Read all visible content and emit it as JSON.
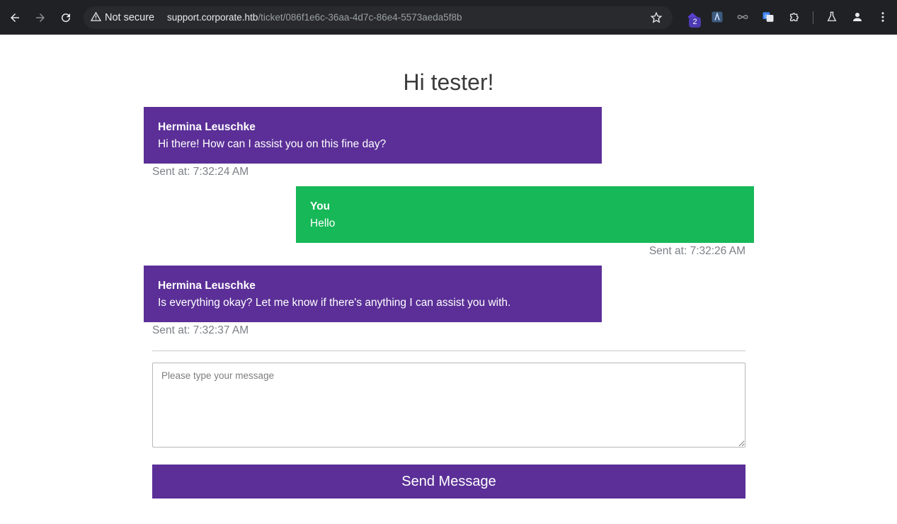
{
  "browser": {
    "security_label": "Not secure",
    "url_host": "support.corporate.htb",
    "url_path": "/ticket/086f1e6c-36aa-4d7c-86e4-5573aeda5f8b",
    "extension_badge": "2",
    "icons": [
      "back-icon",
      "forward-icon",
      "reload-icon",
      "warning-icon",
      "star-icon",
      "extension-icon",
      "puzzle-icon",
      "labs-icon",
      "profile-icon",
      "menu-icon"
    ]
  },
  "page": {
    "greeting": "Hi tester!",
    "messages": [
      {
        "sender": "Hermina Leuschke",
        "text": "Hi there! How can I assist you on this fine day?",
        "sent_at": "Sent at: 7:32:24 AM",
        "role": "agent"
      },
      {
        "sender": "You",
        "text": "Hello",
        "sent_at": "Sent at: 7:32:26 AM",
        "role": "user"
      },
      {
        "sender": "Hermina Leuschke",
        "text": "Is everything okay? Let me know if there's anything I can assist you with.",
        "sent_at": "Sent at: 7:32:37 AM",
        "role": "agent"
      }
    ],
    "composer": {
      "placeholder": "Please type your message",
      "value": "",
      "send_label": "Send Message"
    }
  },
  "colors": {
    "agent_bubble": "#5b2f97",
    "user_bubble": "#17b858",
    "send_button": "#5b2f97"
  }
}
